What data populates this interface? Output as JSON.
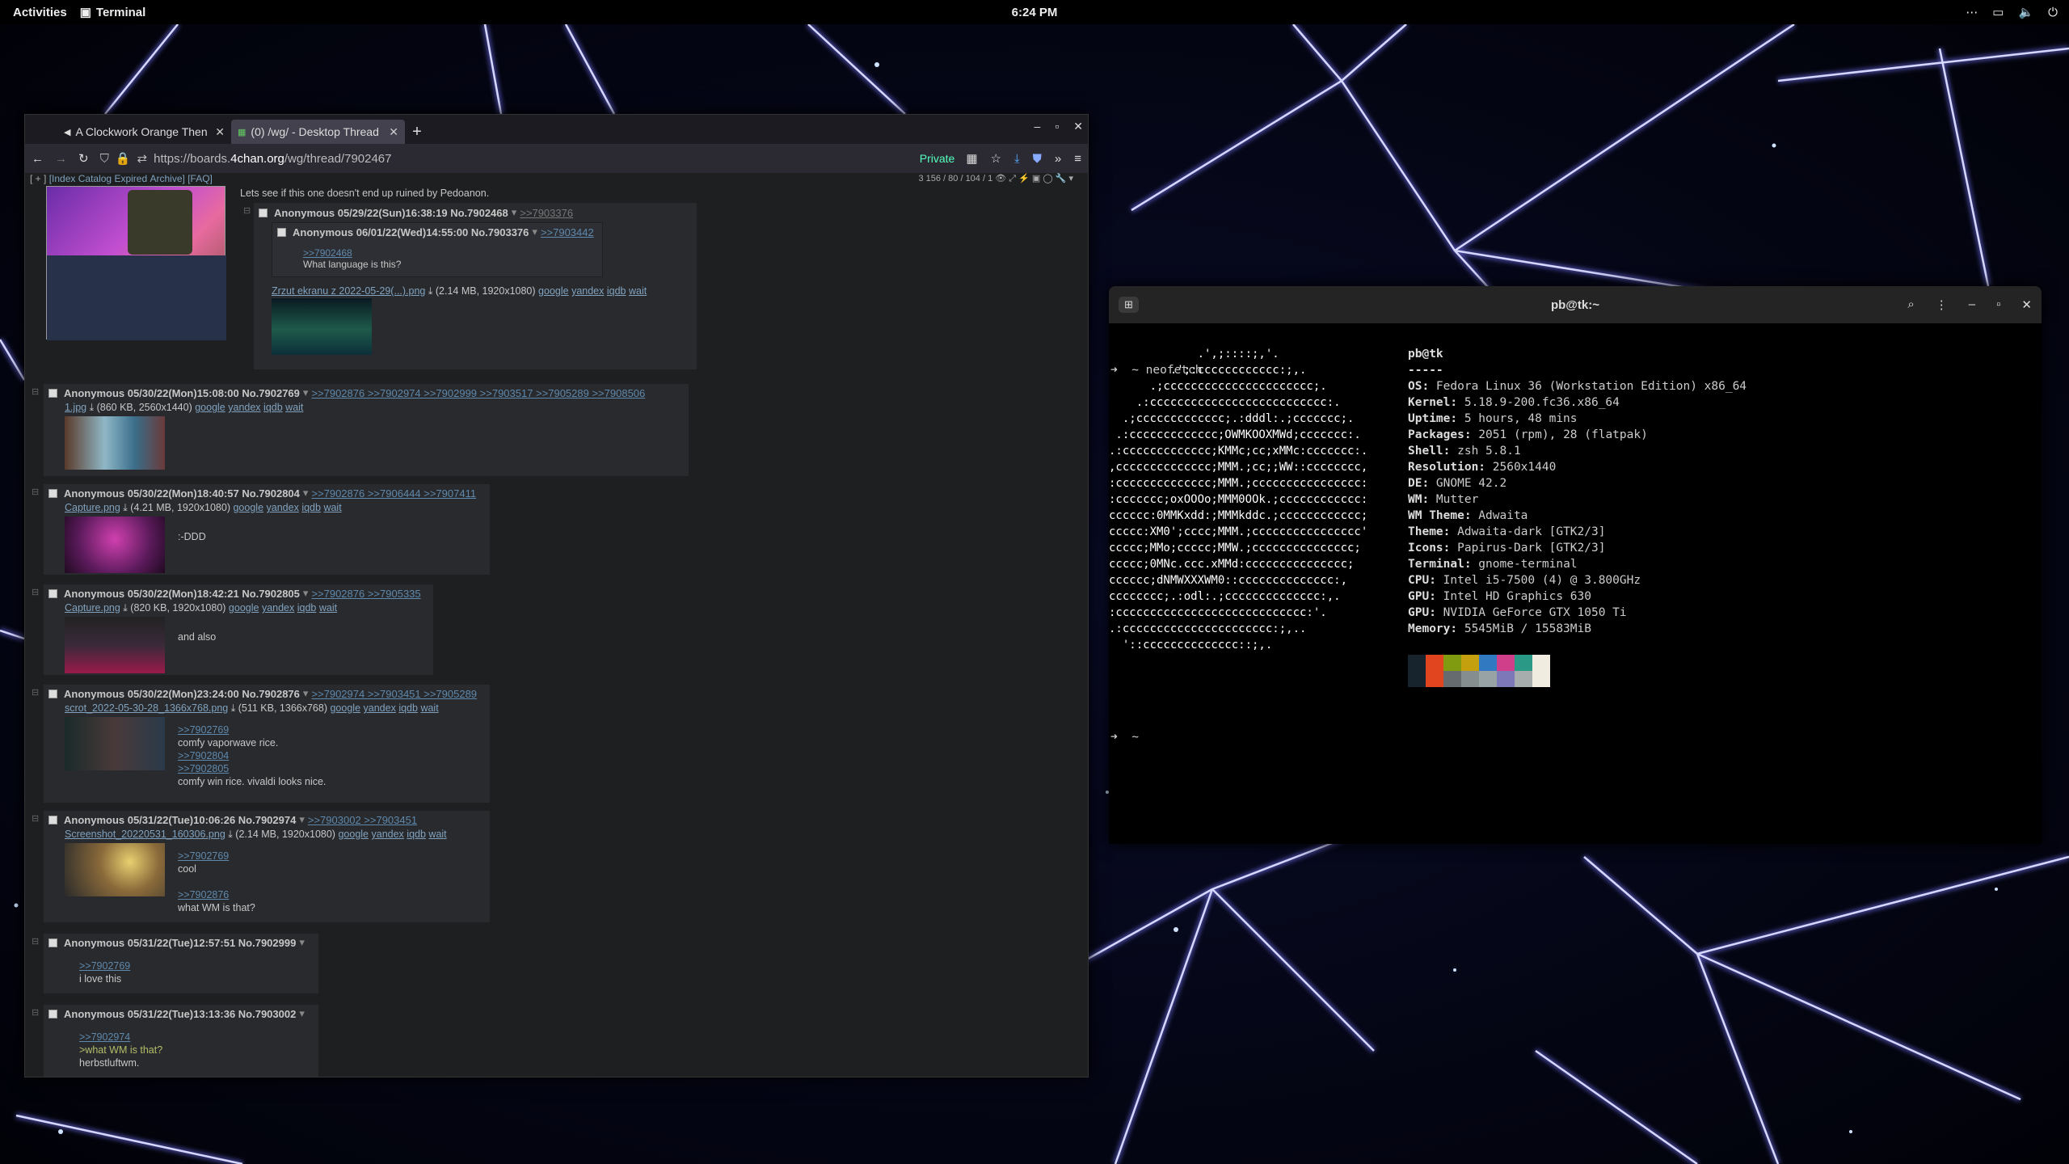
{
  "topbar": {
    "activities": "Activities",
    "app_name": "Terminal",
    "clock": "6:24 PM"
  },
  "browser": {
    "tabs": [
      {
        "title": "A Clockwork Orange Then"
      },
      {
        "title": "(0) /wg/ - Desktop Thread"
      }
    ],
    "url_prefix": "https://boards.",
    "url_domain": "4chan.org",
    "url_path": "/wg/thread/7902467",
    "private_label": "Private",
    "board_nav": {
      "plus": "[ + ]",
      "index": "[Index",
      "catalog": "Catalog",
      "expired": "Expired",
      "archive": "Archive]",
      "faq": "[FAQ]"
    },
    "stats": "3 156 / 80 / 104 / 1",
    "op_text": "Lets see if this one doesn't end up ruined by Pedoanon.",
    "posts": [
      {
        "header": "Anonymous 05/29/22(Sun)16:38:19 No.7902468",
        "replies": ">>7903376",
        "inline": {
          "header": "Anonymous 06/01/22(Wed)14:55:00 No.7903376",
          "replies": ">>7903442",
          "quote": ">>7902468",
          "text": "What language is this?"
        },
        "file": "Zrzut ekranu z 2022-05-29(...).png",
        "file_meta": "(2.14 MB, 1920x1080)"
      },
      {
        "header": "Anonymous 05/30/22(Mon)15:08:00 No.7902769",
        "replies": ">>7902876 >>7902974 >>7902999 >>7903517 >>7905289 >>7908506",
        "file": "1.jpg",
        "file_meta": "(860 KB, 2560x1440)"
      },
      {
        "header": "Anonymous 05/30/22(Mon)18:40:57 No.7902804",
        "replies": ">>7902876 >>7906444 >>7907411",
        "file": "Capture.png",
        "file_meta": "(4.21 MB, 1920x1080)",
        "text": ":-DDD"
      },
      {
        "header": "Anonymous 05/30/22(Mon)18:42:21 No.7902805",
        "replies": ">>7902876 >>7905335",
        "file": "Capture.png",
        "file_meta": "(820 KB, 1920x1080)",
        "text": "and also"
      },
      {
        "header": "Anonymous 05/30/22(Mon)23:24:00 No.7902876",
        "replies": ">>7902974 >>7903451 >>7905289",
        "file": "scrot_2022-05-30-28_1366x768.png",
        "file_meta": "(511 KB, 1366x768)",
        "q1": ">>7902769",
        "t1": "comfy vaporwave rice.",
        "q2": ">>7902804",
        "q3": ">>7902805",
        "t2": "comfy win rice. vivaldi looks nice."
      },
      {
        "header": "Anonymous 05/31/22(Tue)10:06:26 No.7902974",
        "replies": ">>7903002 >>7903451",
        "file": "Screenshot_20220531_160306.png",
        "file_meta": "(2.14 MB, 1920x1080)",
        "q1": ">>7902769",
        "t1": "cool",
        "q2": ">>7902876",
        "t2": "what WM is that?"
      },
      {
        "header": "Anonymous 05/31/22(Tue)12:57:51 No.7902999",
        "q1": ">>7902769",
        "t1": "i love this"
      },
      {
        "header": "Anonymous 05/31/22(Tue)13:13:36 No.7903002",
        "q1": ">>7902974",
        "g1": ">what WM is that?",
        "t1": "herbstluftwm."
      }
    ],
    "file_links": {
      "google": "google",
      "yandex": "yandex",
      "iqdb": "iqdb",
      "wait": "wait"
    }
  },
  "terminal": {
    "title": "pb@tk:~",
    "prompt_cmd": "➜  ~ neofetch",
    "prompt_end": "➜  ~",
    "ascii": [
      "             .',;::::;,'.",
      "         .';:cccccccccccc:;,.",
      "      .;cccccccccccccccccccccc;.",
      "    .:cccccccccccccccccccccccccc:.",
      "  .;ccccccccccccc;.:dddl:.;ccccccc;.",
      " .:ccccccccccccc;OWMKOOXMWd;ccccccc:.",
      ".:ccccccccccccc;KMMc;cc;xMMc:ccccccc:.",
      ",cccccccccccccc;MMM.;cc;;WW::cccccccc,",
      ":cccccccccccccc;MMM.;cccccccccccccccc:",
      ":ccccccc;oxOOOo;MMM0OOk.;cccccccccccc:",
      "cccccc:0MMKxdd:;MMMkddc.;cccccccccccc;",
      "ccccc:XM0';cccc;MMM.;cccccccccccccccc'",
      "ccccc;MMo;ccccc;MMW.;ccccccccccccccc;",
      "ccccc;0MNc.ccc.xMMd:ccccccccccccccc;",
      "cccccc;dNMWXXXWM0::cccccccccccccc:,",
      "cccccccc;.:odl:.;cccccccccccccc:,.",
      ":cccccccccccccccccccccccccccc:'.",
      ".:cccccccccccccccccccccc:;,..",
      "  '::cccccccccccccc::;,."
    ],
    "info": [
      {
        "k": "pb@tk",
        "v": ""
      },
      {
        "k": "-----",
        "v": ""
      },
      {
        "k": "OS:",
        "v": " Fedora Linux 36 (Workstation Edition) x86_64"
      },
      {
        "k": "Kernel:",
        "v": " 5.18.9-200.fc36.x86_64"
      },
      {
        "k": "Uptime:",
        "v": " 5 hours, 48 mins"
      },
      {
        "k": "Packages:",
        "v": " 2051 (rpm), 28 (flatpak)"
      },
      {
        "k": "Shell:",
        "v": " zsh 5.8.1"
      },
      {
        "k": "Resolution:",
        "v": " 2560x1440"
      },
      {
        "k": "DE:",
        "v": " GNOME 42.2"
      },
      {
        "k": "WM:",
        "v": " Mutter"
      },
      {
        "k": "WM Theme:",
        "v": " Adwaita"
      },
      {
        "k": "Theme:",
        "v": " Adwaita-dark [GTK2/3]"
      },
      {
        "k": "Icons:",
        "v": " Papirus-Dark [GTK2/3]"
      },
      {
        "k": "Terminal:",
        "v": " gnome-terminal"
      },
      {
        "k": "CPU:",
        "v": " Intel i5-7500 (4) @ 3.800GHz"
      },
      {
        "k": "GPU:",
        "v": " Intel HD Graphics 630"
      },
      {
        "k": "GPU:",
        "v": " NVIDIA GeForce GTX 1050 Ti"
      },
      {
        "k": "Memory:",
        "v": " 5545MiB / 15583MiB"
      }
    ],
    "colors_top": [
      "#17242d",
      "#e0451f",
      "#809b0f",
      "#c5a00e",
      "#3179c0",
      "#cf3f8a",
      "#2a9a86",
      "#f0ece0"
    ],
    "colors_bottom": [
      "#17242d",
      "#e0451f",
      "#656b6e",
      "#858d8f",
      "#98a3a5",
      "#7d78b8",
      "#a7adad",
      "#f0ece0"
    ]
  }
}
